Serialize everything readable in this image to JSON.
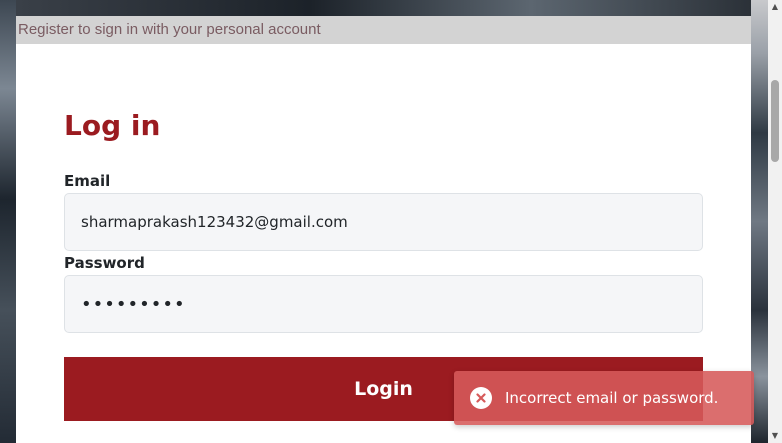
{
  "header": {
    "register_text": "Register to sign in with your personal account"
  },
  "form": {
    "title": "Log in",
    "email_label": "Email",
    "email_value": "sharmaprakash123432@gmail.com",
    "password_label": "Password",
    "password_value": "•••••••••",
    "login_label": "Login"
  },
  "toast": {
    "icon": "error-circle-x-icon",
    "message": "Incorrect email or password."
  },
  "colors": {
    "brand": "#9b1b20",
    "toast_bg": "#d65a5a",
    "register_bar": "#d3d3d3"
  }
}
